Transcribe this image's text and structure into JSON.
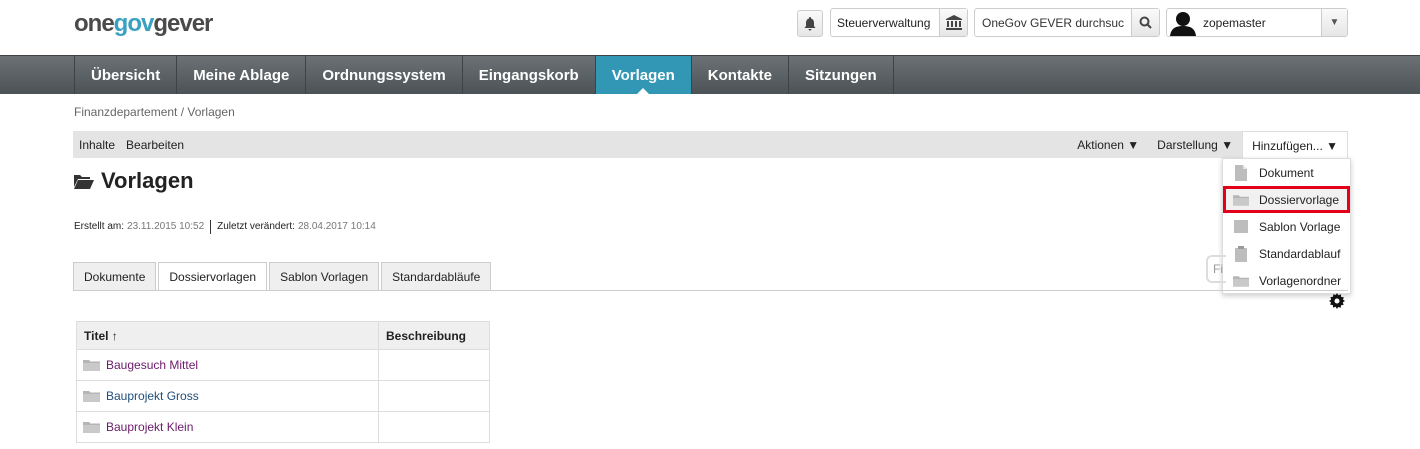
{
  "header": {
    "logo_part1": "one",
    "logo_part2": "gov",
    "logo_part3": "gever",
    "org_unit": "Steuerverwaltung",
    "search_placeholder": "OneGov GEVER durchsuc",
    "username": "zopemaster"
  },
  "nav": [
    "Übersicht",
    "Meine Ablage",
    "Ordnungssystem",
    "Eingangskorb",
    "Vorlagen",
    "Kontakte",
    "Sitzungen"
  ],
  "nav_active_index": 4,
  "breadcrumb": "Finanzdepartement / Vorlagen",
  "toolbar": {
    "left": [
      "Inhalte",
      "Bearbeiten"
    ],
    "actions": "Aktionen ▼",
    "display": "Darstellung ▼",
    "add": "Hinzufügen... ▼"
  },
  "add_menu": [
    {
      "label": "Dokument",
      "icon": "document-icon"
    },
    {
      "label": "Dossiervorlage",
      "icon": "folder-icon",
      "highlighted": true
    },
    {
      "label": "Sablon Vorlage",
      "icon": "sablon-icon"
    },
    {
      "label": "Standardablauf",
      "icon": "clipboard-icon"
    },
    {
      "label": "Vorlagenordner",
      "icon": "folder-icon"
    }
  ],
  "page": {
    "title": "Vorlagen",
    "created_label": "Erstellt am:",
    "created_value": "23.11.2015 10:52",
    "modified_label": "Zuletzt verändert:",
    "modified_value": "28.04.2017 10:14"
  },
  "tabs": [
    "Dokumente",
    "Dossiervorlagen",
    "Sablon Vorlagen",
    "Standardabläufe"
  ],
  "tab_active_index": 1,
  "filter_placeholder": "Fi",
  "table": {
    "columns": [
      "Titel ↑",
      "Beschreibung"
    ],
    "rows": [
      {
        "title": "Baugesuch Mittel",
        "description": ""
      },
      {
        "title": "Bauprojekt Gross",
        "description": ""
      },
      {
        "title": "Bauprojekt Klein",
        "description": ""
      }
    ]
  }
}
